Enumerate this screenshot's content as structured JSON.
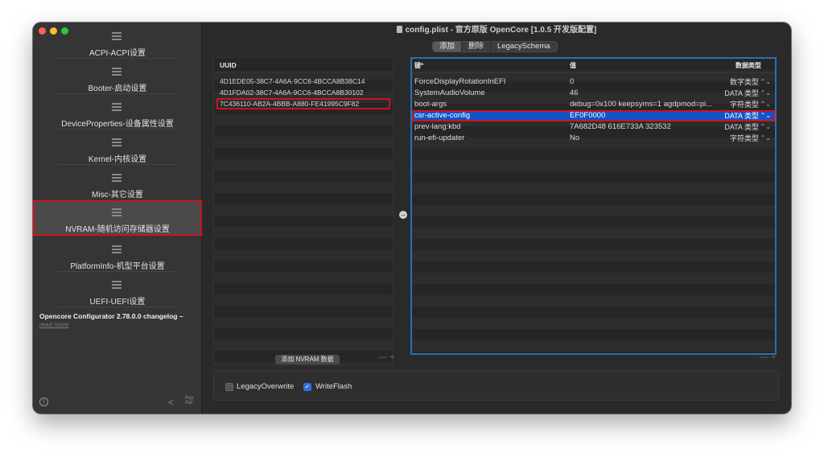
{
  "window": {
    "title": "config.plist - 官方原版 OpenCore [1.0.5 开发版配置]",
    "traffic_colors": {
      "close": "#ff5f57",
      "minimize": "#febc2e",
      "zoom": "#28c840"
    }
  },
  "sidebar": {
    "items": [
      {
        "label": "ACPI-ACPI设置",
        "icon": "list-icon"
      },
      {
        "label": "Booter-启动设置",
        "icon": "list-icon"
      },
      {
        "label": "DeviceProperties-设备属性设置",
        "icon": "list-icon"
      },
      {
        "label": "Kernel-内核设置",
        "icon": "list-icon"
      },
      {
        "label": "Misc-其它设置",
        "icon": "list-icon"
      },
      {
        "label": "NVRAM-随机访问存储器设置",
        "icon": "list-icon",
        "active": true
      },
      {
        "label": "PlatformInfo-机型平台设置",
        "icon": "list-icon"
      },
      {
        "label": "UEFI-UEFI设置",
        "icon": "list-icon"
      }
    ],
    "changelog": "Opencore Configurator 2.78.0.0 changelog –",
    "read_more": "read more",
    "paypal": "Pay\nPal"
  },
  "toolbar": {
    "segments": [
      "添加",
      "删除",
      "LegacySchema"
    ],
    "selected": "添加"
  },
  "uuid_panel": {
    "header": "UUID",
    "rows": [
      "4D1EDE05-38C7-4A6A-9CC6-4BCCA8B38C14",
      "4D1FDA02-38C7-4A6A-9CC6-4BCCA8B30102",
      "7C436110-AB2A-4BBB-A880-FE41995C9F82"
    ],
    "selected_index": 2,
    "add_button": "添加 NVRAM 数据",
    "plus_minus": "— +"
  },
  "data_panel": {
    "headers": {
      "key": "键*",
      "value": "值",
      "type": "数据类型"
    },
    "rows": [
      {
        "key": "ForceDisplayRotationInEFI",
        "value": "0",
        "type": "数字类型"
      },
      {
        "key": "SystemAudioVolume",
        "value": "46",
        "type": "DATA 类型"
      },
      {
        "key": "boot-args",
        "value": "debug=0x100 keepsyms=1 agdpmod=pi...",
        "type": "字符类型"
      },
      {
        "key": "csr-active-config",
        "value": "EF0F0000",
        "type": "DATA 类型"
      },
      {
        "key": "prev-lang:kbd",
        "value": "7A682D48 616E733A 323532",
        "type": "DATA 类型"
      },
      {
        "key": "run-efi-updater",
        "value": "No",
        "type": "字符类型"
      }
    ],
    "selected_index": 3,
    "plus_minus": "— +",
    "accent": "#2a6fb5",
    "selection_color": "#1452c6"
  },
  "options": {
    "legacy_overwrite": {
      "label": "LegacyOverwrite",
      "checked": false
    },
    "write_flash": {
      "label": "WriteFlash",
      "checked": true
    }
  },
  "highlight_color": "#c8161d"
}
